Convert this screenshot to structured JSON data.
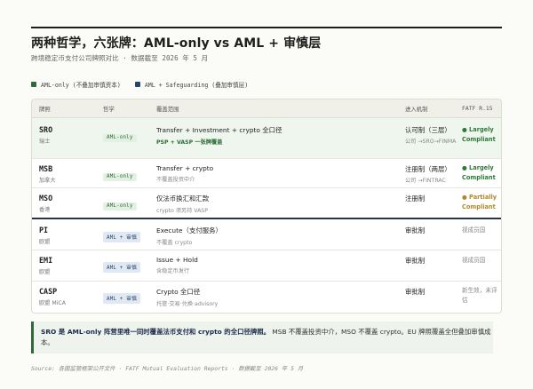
{
  "header": {
    "title": "两种哲学，六张牌：AML-only vs AML + 审慎层",
    "subtitle": "跨境稳定币支付公司牌照对比 · 数据截至 2026 年 5 月"
  },
  "legend": [
    {
      "label": "AML-only (不叠加审慎资本)",
      "color": "#2e6a3a"
    },
    {
      "label": "AML + Safeguarding (叠加审慎层)",
      "color": "#27456b"
    }
  ],
  "table": {
    "columns": [
      "牌照",
      "哲学",
      "覆盖范围",
      "进入机制",
      "FATF R.15"
    ],
    "rows": [
      {
        "license": "SRO",
        "region": "瑞士",
        "philosophy": "AML-only",
        "tone": "green",
        "coverage": "Transfer + Investment + crypto 全口径",
        "coverage_sub": "PSP + VASP 一张牌覆盖",
        "mechanism": "认可制（三层）",
        "mechanism_sub": "公司 →SRO→FINMA",
        "fatf": "● Largely Compliant",
        "fatf_tone": "g"
      },
      {
        "license": "MSB",
        "region": "加拿大",
        "philosophy": "AML-only",
        "tone": "green",
        "coverage": "Transfer + crypto",
        "coverage_sub": "不覆盖投资中介",
        "mechanism": "注册制（两层）",
        "mechanism_sub": "公司 →FINTRAC",
        "fatf": "● Largely Compliant",
        "fatf_tone": "g"
      },
      {
        "license": "MSO",
        "region": "香港",
        "philosophy": "AML-only",
        "tone": "green",
        "coverage": "仅法币换汇和汇款",
        "coverage_sub": "crypto 须另持 VASP",
        "mechanism": "注册制",
        "mechanism_sub": "",
        "fatf": "● Partially Compliant",
        "fatf_tone": "y"
      },
      {
        "license": "PI",
        "region": "欧盟",
        "philosophy": "AML + 审慎",
        "tone": "blue",
        "coverage": "Execute（支付服务）",
        "coverage_sub": "不覆盖 crypto",
        "mechanism": "审批制",
        "mechanism_sub": "",
        "fatf": "视成员国",
        "fatf_tone": "n"
      },
      {
        "license": "EMI",
        "region": "欧盟",
        "philosophy": "AML + 审慎",
        "tone": "blue",
        "coverage": "Issue + Hold",
        "coverage_sub": "含稳定币发行",
        "mechanism": "审批制",
        "mechanism_sub": "",
        "fatf": "视成员国",
        "fatf_tone": "n"
      },
      {
        "license": "CASP",
        "region": "欧盟 MiCA",
        "philosophy": "AML + 审慎",
        "tone": "blue",
        "coverage": "Crypto 全口径",
        "coverage_sub": "托管·交易·兑换·advisory",
        "mechanism": "审批制",
        "mechanism_sub": "",
        "fatf": "新生效，未评估",
        "fatf_tone": "n"
      }
    ]
  },
  "note": {
    "bold": "SRO 是 AML-only 阵营里唯一同时覆盖法币支付和 crypto 的全口径牌照。",
    "rest": " MSB 不覆盖投资中介，MSO 不覆盖 crypto。EU 牌照覆盖全但叠加审慎成本。"
  },
  "source": "Source: 各国监管框架公开文件 · FATF Mutual Evaluation Reports · 数据截至 2026 年 5 月"
}
